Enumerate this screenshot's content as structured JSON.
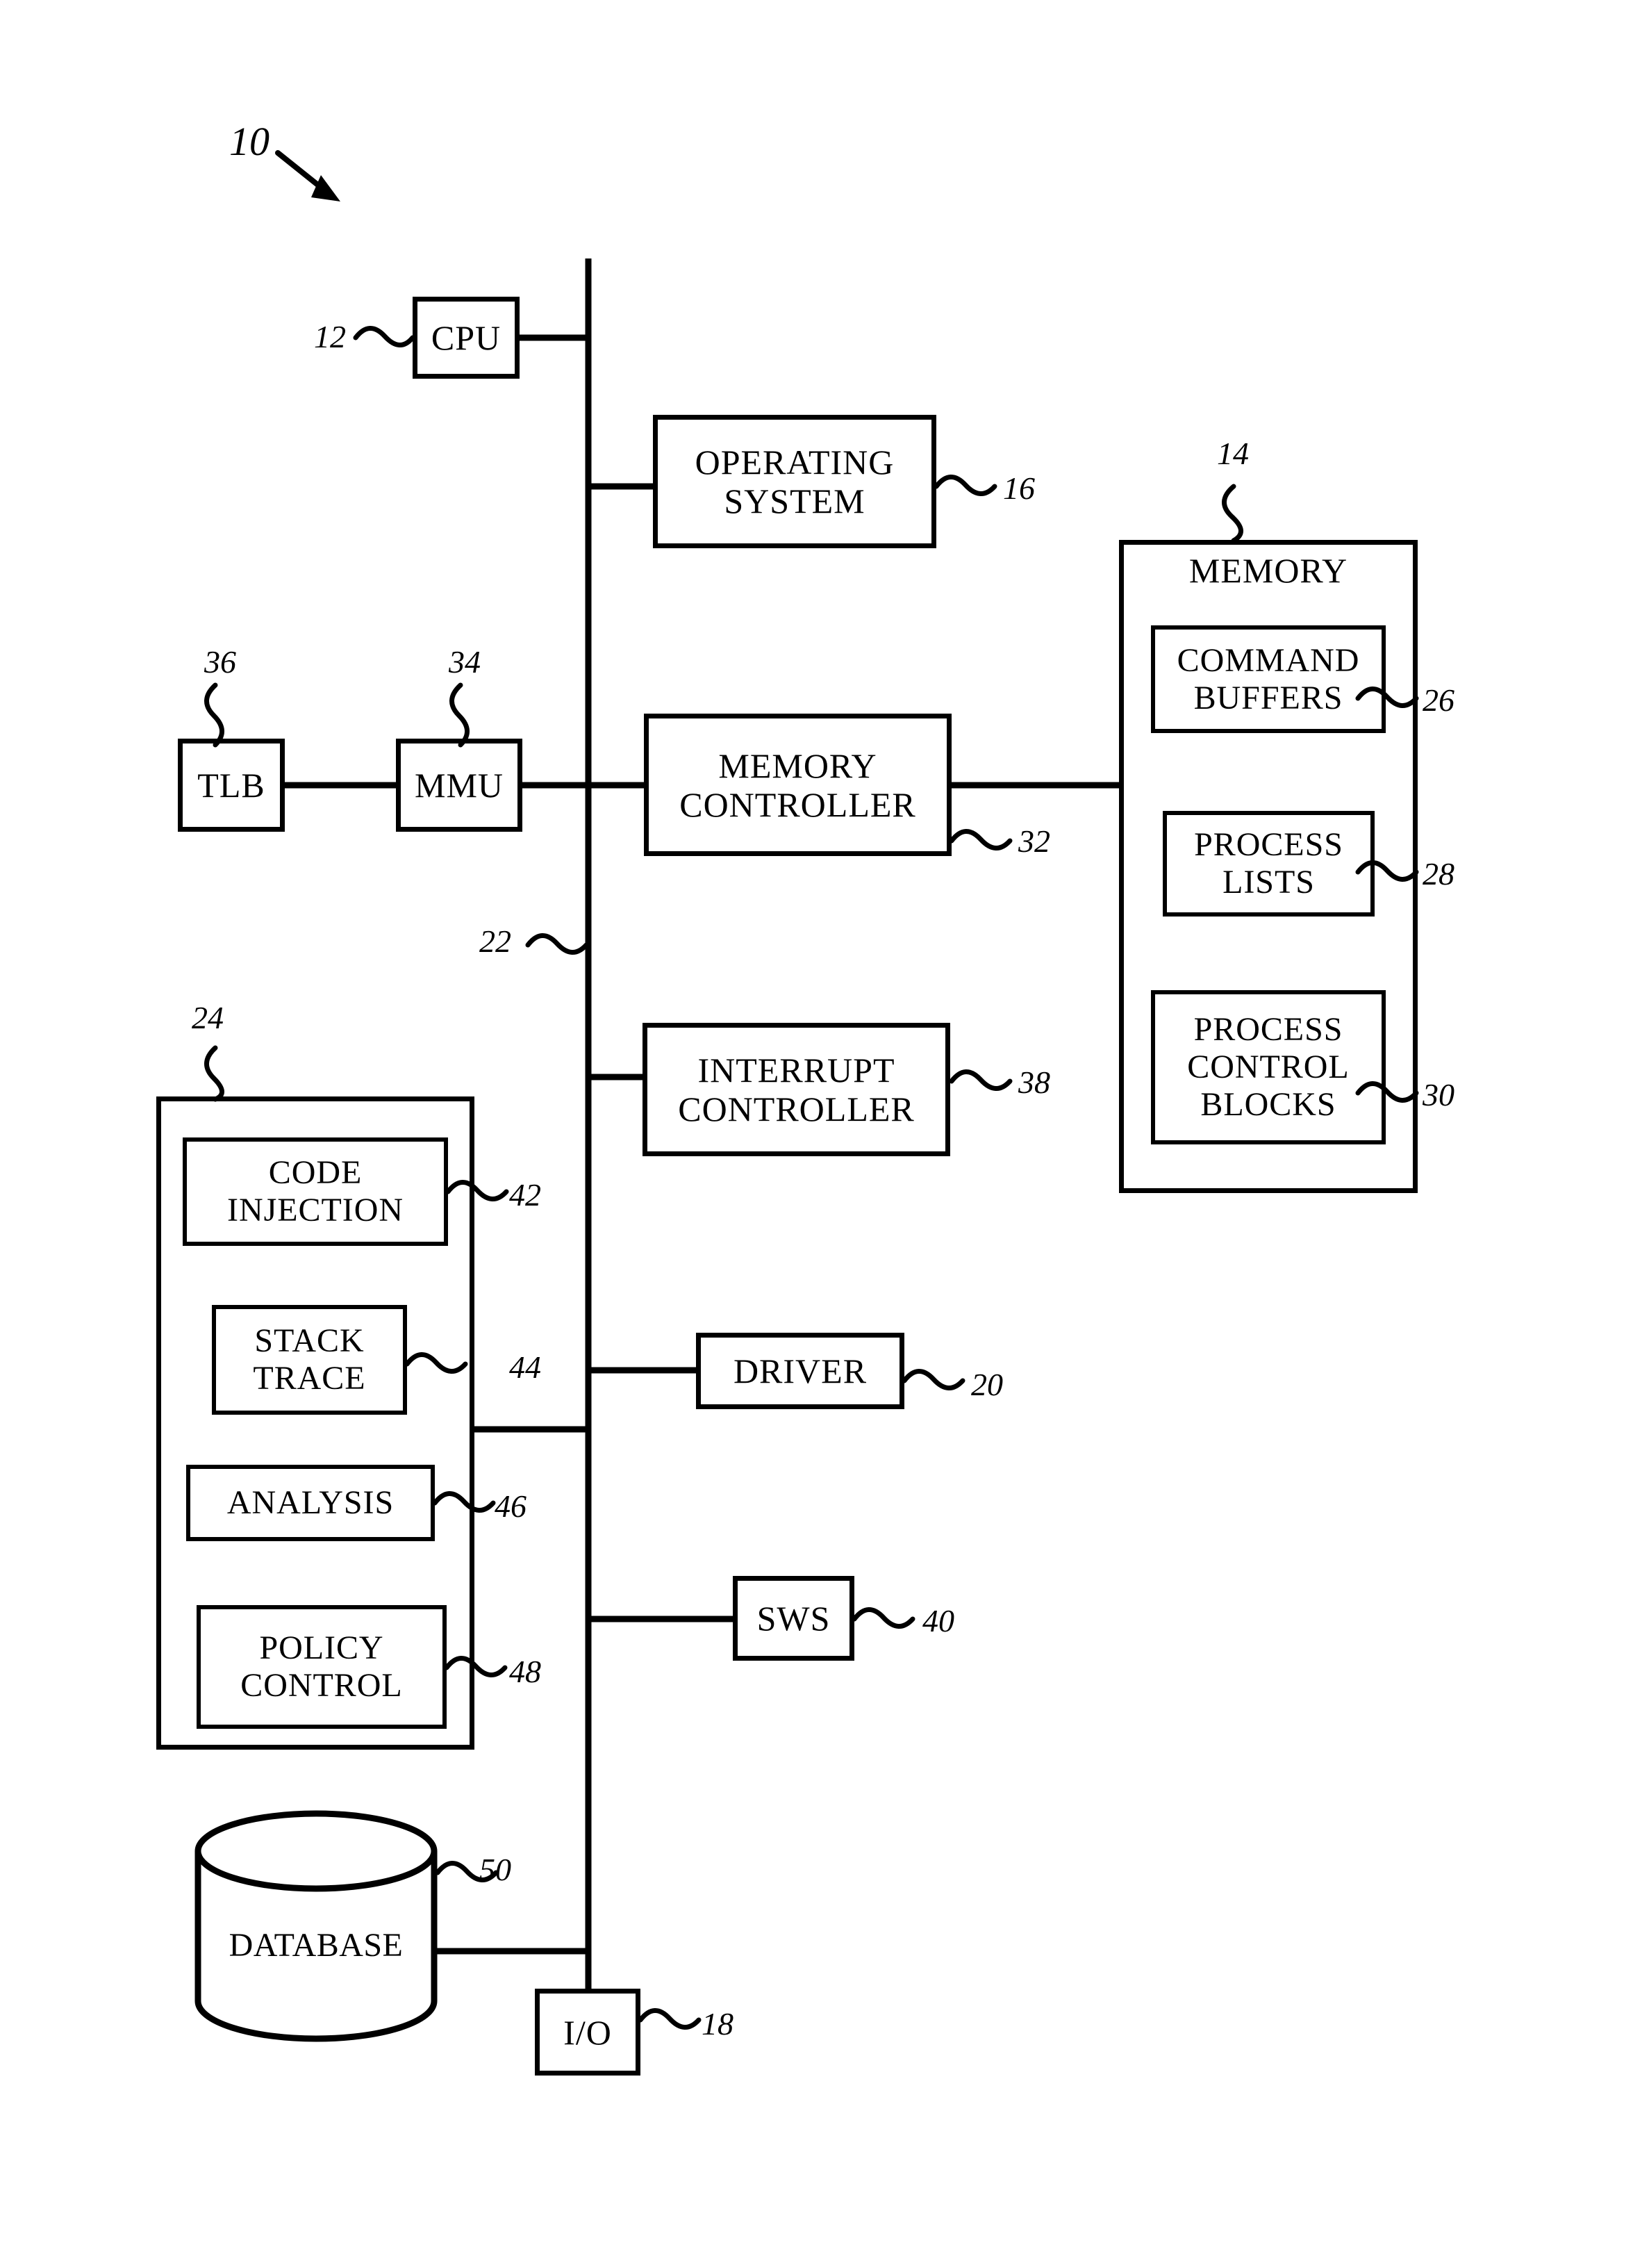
{
  "figure": {
    "title_numeral": "10",
    "bus": {
      "label": "22"
    }
  },
  "blocks": {
    "cpu": {
      "label": "CPU",
      "ref": "12"
    },
    "operating_system": {
      "label": "OPERATING SYSTEM",
      "ref": "16"
    },
    "memory": {
      "label": "MEMORY",
      "ref": "14"
    },
    "command_buffers": {
      "label": "COMMAND BUFFERS",
      "ref": "26"
    },
    "process_lists": {
      "label": "PROCESS LISTS",
      "ref": "28"
    },
    "process_control_blocks": {
      "label": "PROCESS CONTROL BLOCKS",
      "ref": "30"
    },
    "tlb": {
      "label": "TLB",
      "ref": "36"
    },
    "mmu": {
      "label": "MMU",
      "ref": "34"
    },
    "memory_controller": {
      "label": "MEMORY CONTROLLER",
      "ref": "32"
    },
    "interrupt_controller": {
      "label": "INTERRUPT CONTROLLER",
      "ref": "38"
    },
    "analysis_module": {
      "label": "",
      "ref": "24"
    },
    "code_injection": {
      "label": "CODE INJECTION",
      "ref": "42"
    },
    "stack_trace": {
      "label": "STACK TRACE",
      "ref": "44"
    },
    "analysis": {
      "label": "ANALYSIS",
      "ref": "46"
    },
    "policy_control": {
      "label": "POLICY CONTROL",
      "ref": "48"
    },
    "driver": {
      "label": "DRIVER",
      "ref": "20"
    },
    "sws": {
      "label": "SWS",
      "ref": "40"
    },
    "database": {
      "label": "DATABASE",
      "ref": "50"
    },
    "io": {
      "label": "I/O",
      "ref": "18"
    }
  },
  "colors": {
    "stroke": "#000000",
    "background": "#ffffff"
  }
}
